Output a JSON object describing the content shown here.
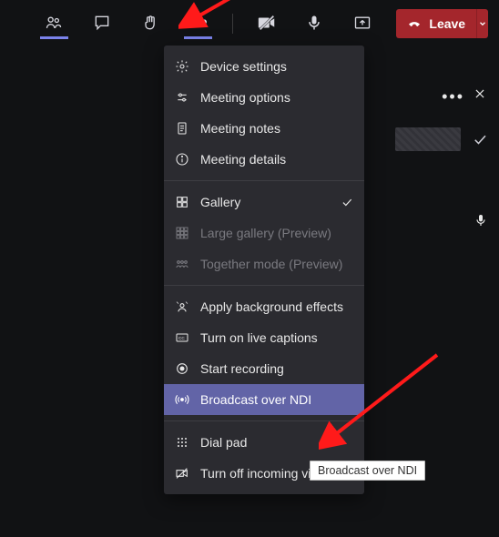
{
  "toolbar": {
    "leave_label": "Leave"
  },
  "menu": {
    "device_settings": "Device settings",
    "meeting_options": "Meeting options",
    "meeting_notes": "Meeting notes",
    "meeting_details": "Meeting details",
    "gallery": "Gallery",
    "large_gallery": "Large gallery (Preview)",
    "together_mode": "Together mode (Preview)",
    "apply_background": "Apply background effects",
    "live_captions": "Turn on live captions",
    "start_recording": "Start recording",
    "broadcast_ndi": "Broadcast over NDI",
    "dial_pad": "Dial pad",
    "turn_off_incoming": "Turn off incoming video"
  },
  "tooltip": "Broadcast over NDI"
}
